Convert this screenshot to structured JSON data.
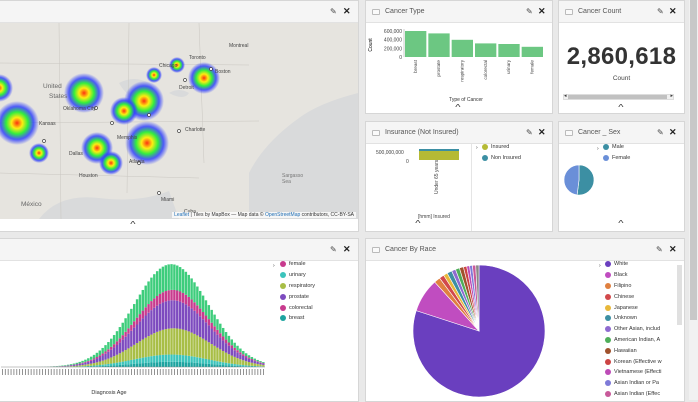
{
  "colors": {
    "bar_green": "#6cc782",
    "insured": "#b5ba35",
    "non_insured": "#3c8fa3",
    "male": "#3c8fa3",
    "female": "#6a8fd8",
    "pie_white": "#6a3fbf"
  },
  "icons": {
    "edit": "pencil-icon",
    "close": "close-icon",
    "collapse": "chevron-up-icon",
    "grip": "panel-grip-icon"
  },
  "map": {
    "attribution_leaflet": "Leaflet",
    "attribution_rest": " | Tiles by MapBox — Map data © ",
    "attribution_osm": "OpenStreetMap",
    "attribution_tail": " contributors, CC-BY-SA",
    "labels": [
      {
        "text": "United",
        "cls": "l1"
      },
      {
        "text": "States",
        "cls": "l2"
      },
      {
        "text": "Oklahoma City",
        "cls": "l3"
      },
      {
        "text": "Chicago",
        "cls": "l4"
      },
      {
        "text": "Toronto",
        "cls": "l5"
      },
      {
        "text": "Montreal",
        "cls": "l6"
      },
      {
        "text": "Boston",
        "cls": "l7"
      },
      {
        "text": "Atlanta",
        "cls": "l8"
      },
      {
        "text": "Dallas",
        "cls": "l9"
      },
      {
        "text": "Houston",
        "cls": "l10"
      },
      {
        "text": "Charlotte",
        "cls": "l11"
      },
      {
        "text": "Miami",
        "cls": "l12"
      },
      {
        "text": "México",
        "cls": "l13"
      },
      {
        "text": "Sargasso Sea",
        "cls": "l14"
      },
      {
        "text": "Cuba",
        "cls": "l15"
      },
      {
        "text": "Memphis",
        "cls": "l16"
      },
      {
        "text": "Kansas",
        "cls": "l17"
      },
      {
        "text": "Detroit",
        "cls": "l18"
      }
    ]
  },
  "cancer_type": {
    "title": "Cancer Type",
    "chart_data": {
      "type": "bar",
      "categories": [
        "breast",
        "prostate",
        "respiratory",
        "colorectal",
        "urinary",
        "female"
      ],
      "values": [
        650000,
        590000,
        430000,
        340000,
        325000,
        255000
      ],
      "ylim": [
        0,
        700000
      ],
      "yticks": [
        "600,000",
        "400,000",
        "200,000",
        "0"
      ],
      "ylabel": "Count",
      "xlabel": "Type of Cancer"
    }
  },
  "cancer_count": {
    "title": "Cancer Count",
    "value": "2,860,618",
    "label": "Count"
  },
  "insurance": {
    "title": "Insurance (Not Insured)",
    "chart_data": {
      "type": "bar",
      "stacked": true,
      "categories": [
        "Under 65 years"
      ],
      "series": [
        {
          "name": "Insured",
          "values": [
            0.93
          ]
        },
        {
          "name": "Non Insured",
          "values": [
            0.07
          ]
        }
      ],
      "yticks": [
        "500,000,000",
        "0"
      ],
      "xlabel": "[hmm] Insured"
    },
    "legend": [
      "Insured",
      "Non Insured"
    ]
  },
  "sex": {
    "title": "Cancer _ Sex",
    "chart_data": {
      "type": "pie",
      "labels": [
        "Male",
        "Female"
      ],
      "values": [
        0.52,
        0.48
      ]
    },
    "legend": [
      "Male",
      "Female"
    ]
  },
  "age": {
    "title": "",
    "chart_data": {
      "type": "bar",
      "stacked": true,
      "xlabel": "Diagnosis Age",
      "series": [
        {
          "name": "breast",
          "color": "#1da4a0"
        },
        {
          "name": "urinary",
          "color": "#3cc4bc"
        },
        {
          "name": "respiratory",
          "color": "#a8be46"
        },
        {
          "name": "prostate",
          "color": "#7d4bbf"
        },
        {
          "name": "colorectal",
          "color": "#c83b8e"
        },
        {
          "name": "female",
          "color": "#3ecd7c"
        }
      ]
    },
    "legend": [
      "female",
      "urinary",
      "respiratory",
      "prostate",
      "colorectal",
      "breast"
    ]
  },
  "race": {
    "title": "Cancer By Race",
    "chart_data": {
      "type": "pie",
      "labels": [
        "White",
        "Black",
        "Filipino",
        "Chinese",
        "Japanese",
        "Unknown",
        "Other Asian, includ",
        "American Indian, A",
        "Hawaiian",
        "Korean (Effective w",
        "Vietnamese (Effecti",
        "Asian Indian or Pa",
        "Asian Indian (Effec",
        "Other"
      ],
      "values": [
        0.8,
        0.083,
        0.015,
        0.012,
        0.01,
        0.012,
        0.01,
        0.01,
        0.01,
        0.008,
        0.007,
        0.007,
        0.008,
        0.008
      ]
    },
    "legend": [
      "White",
      "Black",
      "Filipino",
      "Chinese",
      "Japanese",
      "Unknown",
      "Other Asian, includ",
      "American Indian, A",
      "Hawaiian",
      "Korean (Effective w",
      "Vietnamese (Effecti",
      "Asian Indian or Pa",
      "Asian Indian (Effec",
      "Other"
    ]
  }
}
